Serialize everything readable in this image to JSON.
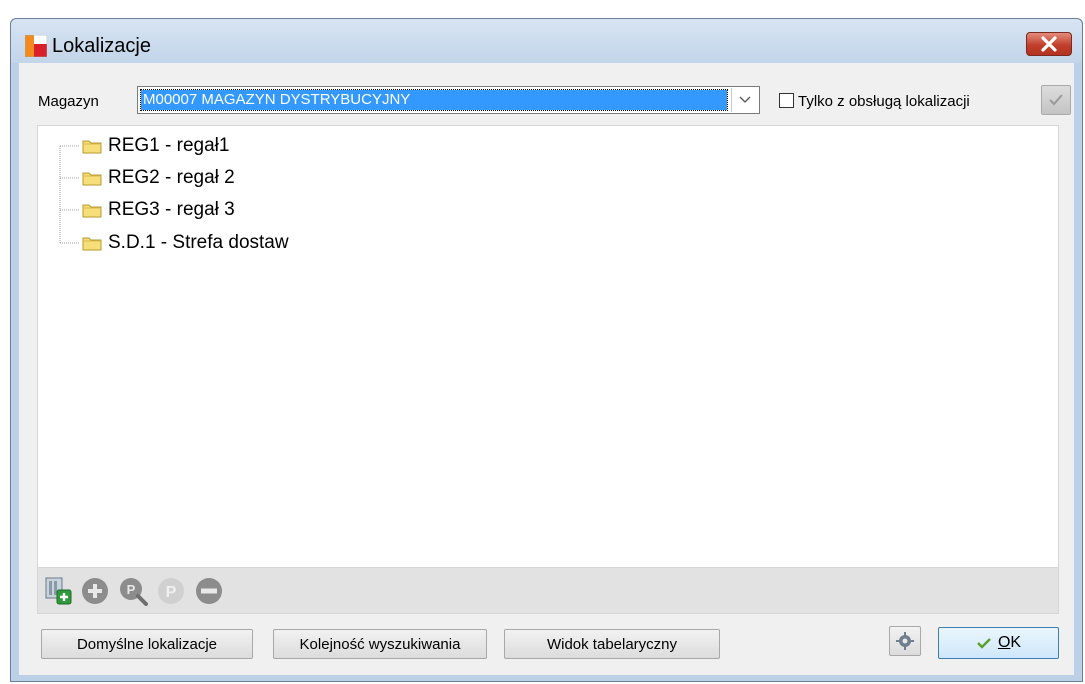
{
  "window": {
    "title": "Lokalizacje"
  },
  "filter": {
    "warehouse_label": "Magazyn",
    "warehouse_value": "M00007 MAGAZYN DYSTRYBUCYJNY",
    "only_with_locations_label": "Tylko z obsługą lokalizacji",
    "only_with_locations_checked": false
  },
  "tree": {
    "nodes": [
      {
        "label": "REG1 - regał1"
      },
      {
        "label": "REG2 - regał 2"
      },
      {
        "label": "REG3 - regał 3"
      },
      {
        "label": "S.D.1 - Strefa dostaw"
      }
    ]
  },
  "toolbar": {
    "icons": [
      "add-table-icon",
      "add-icon",
      "preview-icon",
      "p-icon",
      "remove-icon"
    ]
  },
  "buttons": {
    "default_locations": "Domyślne lokalizacje",
    "search_order": "Kolejność wyszukiwania",
    "table_view": "Widok tabelaryczny",
    "ok_prefix": "",
    "ok_underlined": "O",
    "ok_rest": "K"
  },
  "colors": {
    "selection": "#3399ff",
    "close_button": "#c0402c",
    "folder": "#f6de79",
    "icon_gray": "#8c8c8c"
  }
}
